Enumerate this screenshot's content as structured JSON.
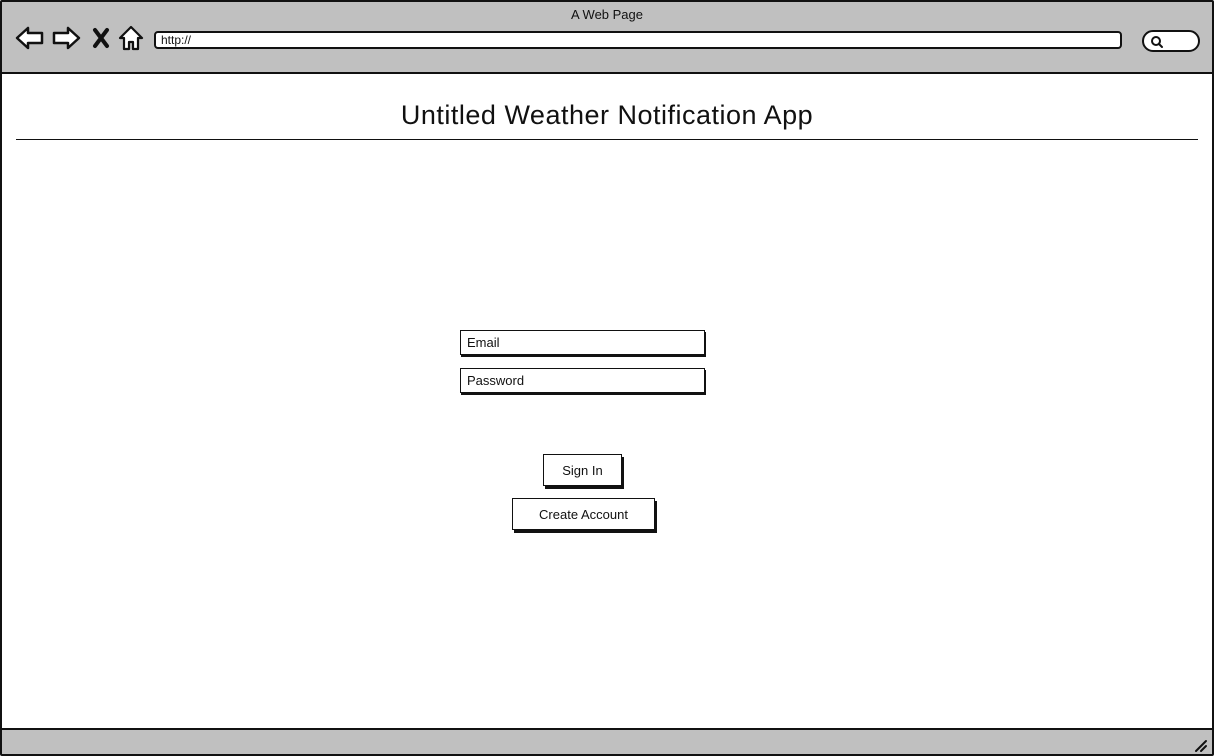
{
  "browser": {
    "window_title": "A Web Page",
    "url": "http://",
    "nav_icons": [
      "back-arrow-icon",
      "forward-arrow-icon",
      "close-icon",
      "home-icon"
    ],
    "search_icon": "search-icon",
    "chrome_color": "#c0c0c0"
  },
  "page": {
    "title": "Untitled Weather Notification App"
  },
  "login_form": {
    "email_placeholder": "Email",
    "password_placeholder": "Password",
    "sign_in_label": "Sign In",
    "create_account_label": "Create Account"
  }
}
